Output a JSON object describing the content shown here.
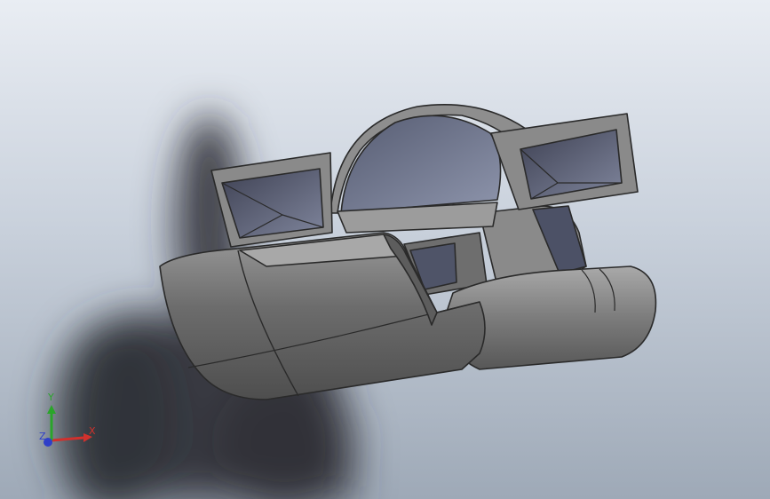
{
  "triad": {
    "x_label": "X",
    "y_label": "Y",
    "z_label": "Z",
    "x_color": "#d0312d",
    "y_color": "#2aa52a",
    "z_color": "#2f3fc8"
  },
  "model": {
    "icon": "cad-model-icon"
  }
}
